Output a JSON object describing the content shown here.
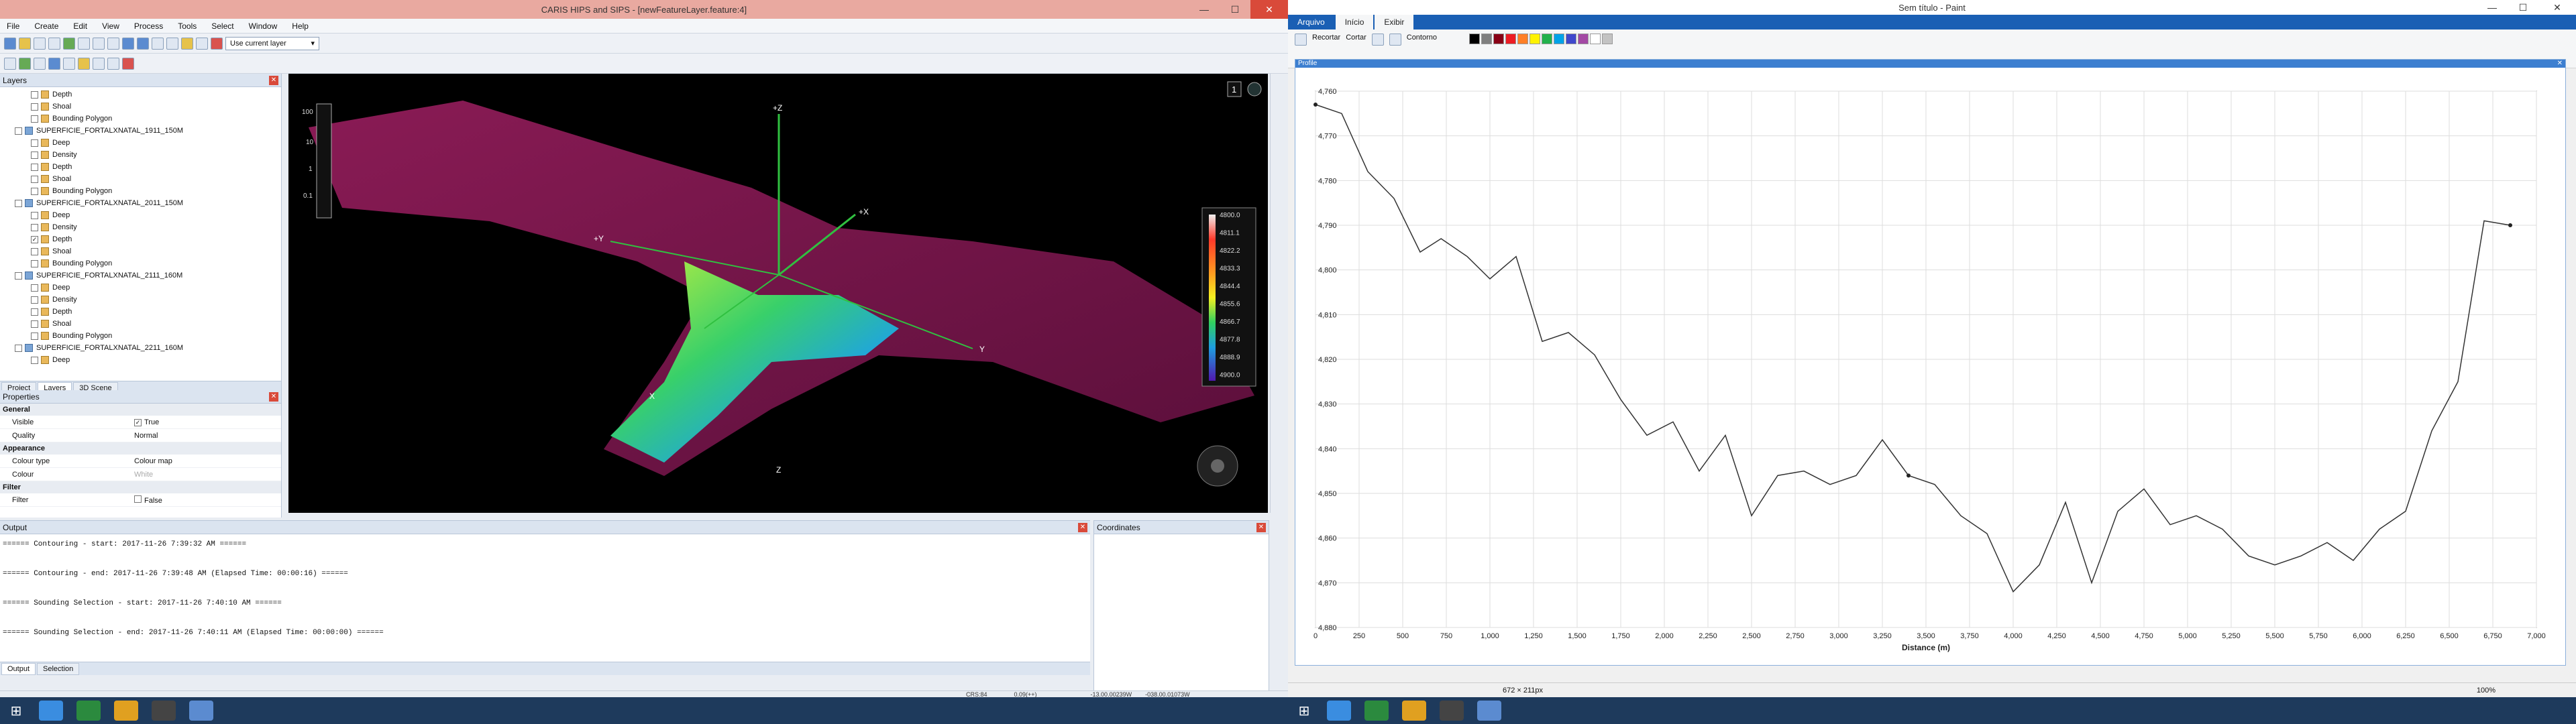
{
  "left": {
    "title": "CARIS HIPS and SIPS - [newFeatureLayer.feature:4]",
    "menu": [
      "File",
      "Create",
      "Edit",
      "View",
      "Process",
      "Tools",
      "Select",
      "Window",
      "Help"
    ],
    "layer_select": "Use current layer",
    "layers_title": "Layers",
    "tree": [
      {
        "label": "Depth",
        "indent": 1,
        "kind": "sub"
      },
      {
        "label": "Shoal",
        "indent": 1,
        "kind": "sub"
      },
      {
        "label": "Bounding Polygon",
        "indent": 1,
        "kind": "sub"
      },
      {
        "label": "SUPERFICIE_FORTALXNATAL_1911_150M",
        "indent": 0,
        "kind": "surf"
      },
      {
        "label": "Deep",
        "indent": 1,
        "kind": "sub"
      },
      {
        "label": "Density",
        "indent": 1,
        "kind": "sub"
      },
      {
        "label": "Depth",
        "indent": 1,
        "kind": "sub"
      },
      {
        "label": "Shoal",
        "indent": 1,
        "kind": "sub"
      },
      {
        "label": "Bounding Polygon",
        "indent": 1,
        "kind": "sub"
      },
      {
        "label": "SUPERFICIE_FORTALXNATAL_2011_150M",
        "indent": 0,
        "kind": "surf"
      },
      {
        "label": "Deep",
        "indent": 1,
        "kind": "sub"
      },
      {
        "label": "Density",
        "indent": 1,
        "kind": "sub"
      },
      {
        "label": "Depth",
        "indent": 1,
        "kind": "sub",
        "checked": true
      },
      {
        "label": "Shoal",
        "indent": 1,
        "kind": "sub"
      },
      {
        "label": "Bounding Polygon",
        "indent": 1,
        "kind": "sub"
      },
      {
        "label": "SUPERFICIE_FORTALXNATAL_2111_160M",
        "indent": 0,
        "kind": "surf"
      },
      {
        "label": "Deep",
        "indent": 1,
        "kind": "sub"
      },
      {
        "label": "Density",
        "indent": 1,
        "kind": "sub"
      },
      {
        "label": "Depth",
        "indent": 1,
        "kind": "sub"
      },
      {
        "label": "Shoal",
        "indent": 1,
        "kind": "sub"
      },
      {
        "label": "Bounding Polygon",
        "indent": 1,
        "kind": "sub"
      },
      {
        "label": "SUPERFICIE_FORTALXNATAL_2211_160M",
        "indent": 0,
        "kind": "surf"
      },
      {
        "label": "Deep",
        "indent": 1,
        "kind": "sub"
      }
    ],
    "bottom_tabs": [
      "Project",
      "Layers",
      "3D Scene"
    ],
    "properties_title": "Properties",
    "properties": [
      {
        "group": "General"
      },
      {
        "key": "Visible",
        "value": "True",
        "check": true
      },
      {
        "key": "Quality",
        "value": "Normal"
      },
      {
        "group": "Appearance"
      },
      {
        "key": "Colour type",
        "value": "Colour map"
      },
      {
        "key": "Colour",
        "value": "White",
        "muted": true
      },
      {
        "group": "Filter"
      },
      {
        "key": "Filter",
        "value": "False",
        "check": false
      }
    ],
    "scene": {
      "axes": [
        "+Z",
        "+X",
        "+Y",
        "Y",
        "X",
        "Z"
      ],
      "scale_ticks": [
        "100",
        "10",
        "1",
        "0.1"
      ],
      "legend": [
        "4800.0",
        "4811.1",
        "4822.2",
        "4833.3",
        "4844.4",
        "4855.6",
        "4866.7",
        "4877.8",
        "4888.9",
        "4900.0"
      ],
      "page_num": "1"
    },
    "output_title": "Output",
    "output_lines": [
      "====== Contouring - start: 2017-11-26 7:39:32 AM ======",
      "",
      "====== Contouring - end: 2017-11-26 7:39:48 AM (Elapsed Time: 00:00:16) ======",
      "",
      "====== Sounding Selection - start: 2017-11-26 7:40:10 AM ======",
      "",
      "====== Sounding Selection - end: 2017-11-26 7:40:11 AM (Elapsed Time: 00:00:00) ======"
    ],
    "output_tabs": [
      "Output",
      "Selection"
    ],
    "coordinates_title": "Coordinates",
    "status": {
      "crs": "CRS:84",
      "scale": "0.09(++)",
      "coord1": "-13.00.00239W",
      "coord2": "-038.00.01073W"
    }
  },
  "right": {
    "title": "Sem título - Paint",
    "ribbon_tabs": [
      "Arquivo",
      "Início",
      "Exibir"
    ],
    "tools": {
      "crop": "Recortar",
      "cut": "Cortar",
      "outline": "Contorno"
    },
    "palette": [
      "#000000",
      "#7f7f7f",
      "#880015",
      "#ed1c24",
      "#ff7f27",
      "#fff200",
      "#22b14c",
      "#00a2e8",
      "#3f48cc",
      "#a349a4",
      "#ffffff",
      "#c3c3c3"
    ],
    "window_title": "Profile",
    "status": {
      "size": "672 × 211px",
      "zoom": "100%"
    }
  },
  "chart_data": {
    "type": "line",
    "xlabel": "Distance (m)",
    "ylabel": "",
    "xlim": [
      0,
      7000
    ],
    "ylim": [
      4760,
      4880
    ],
    "y_inverted": true,
    "xticks": [
      "0",
      "250",
      "500",
      "750",
      "1,000",
      "1,250",
      "1,500",
      "1,750",
      "2,000",
      "2,250",
      "2,500",
      "2,750",
      "3,000",
      "3,250",
      "3,500",
      "3,750",
      "4,000",
      "4,250",
      "4,500",
      "4,750",
      "5,000",
      "5,250",
      "5,500",
      "5,750",
      "6,000",
      "6,250",
      "6,500",
      "6,750",
      "7,000"
    ],
    "yticks": [
      "4,760",
      "4,770",
      "4,780",
      "4,790",
      "4,800",
      "4,810",
      "4,820",
      "4,830",
      "4,840",
      "4,850",
      "4,860",
      "4,870",
      "4,880"
    ],
    "x": [
      0,
      150,
      300,
      450,
      600,
      720,
      870,
      1000,
      1150,
      1300,
      1450,
      1600,
      1750,
      1900,
      2050,
      2200,
      2350,
      2500,
      2650,
      2800,
      2950,
      3100,
      3250,
      3400,
      3550,
      3700,
      3850,
      4000,
      4150,
      4300,
      4450,
      4600,
      4750,
      4900,
      5050,
      5200,
      5350,
      5500,
      5650,
      5800,
      5950,
      6100,
      6250,
      6400,
      6550,
      6700,
      6850
    ],
    "y": [
      4763,
      4765,
      4778,
      4784,
      4796,
      4793,
      4797,
      4802,
      4797,
      4816,
      4814,
      4819,
      4829,
      4837,
      4834,
      4845,
      4837,
      4855,
      4846,
      4845,
      4848,
      4846,
      4838,
      4846,
      4848,
      4855,
      4859,
      4872,
      4866,
      4852,
      4870,
      4854,
      4849,
      4857,
      4855,
      4858,
      4864,
      4866,
      4864,
      4861,
      4865,
      4858,
      4854,
      4836,
      4825,
      4789,
      4790
    ]
  }
}
